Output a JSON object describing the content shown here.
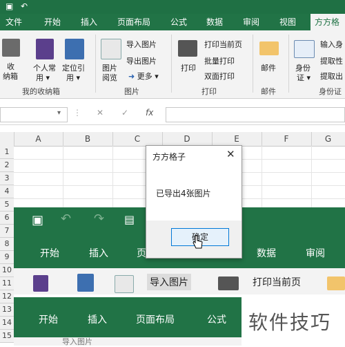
{
  "menu_tabs": [
    "文件",
    "开始",
    "插入",
    "页面布局",
    "公式",
    "数据",
    "审阅",
    "视图",
    "方方格子"
  ],
  "ribbon": {
    "collection": {
      "label1": "收",
      "label2": "纳箱",
      "group": "我的收纳箱"
    },
    "personal": {
      "label1": "个人常",
      "label2": "用 ▾"
    },
    "locate": {
      "label1": "定位引",
      "label2": "用 ▾"
    },
    "pic_browse": {
      "label1": "图片",
      "label2": "阅览"
    },
    "import_pic": "导入图片",
    "export_pic": "导出图片",
    "more": "更多 ▾",
    "pic_group": "图片",
    "print": "打印",
    "print_current": "打印当前页",
    "batch_print": "批量打印",
    "duplex_print": "双面打印",
    "print_group": "打印",
    "mail": "邮件",
    "mail_group": "邮件",
    "id_card": {
      "label1": "身份",
      "label2": "证 ▾"
    },
    "input_id": "输入身",
    "extract1": "提取性",
    "extract2": "提取出",
    "id_group": "身份证"
  },
  "formula_bar": {
    "cancel": "✕",
    "confirm": "✓",
    "fx": "fx"
  },
  "columns": [
    "A",
    "B",
    "C",
    "D",
    "E",
    "F",
    "G"
  ],
  "rows": [
    "1",
    "2",
    "3",
    "4",
    "5",
    "6",
    "7",
    "8",
    "9",
    "10",
    "11",
    "12",
    "13",
    "14",
    "15"
  ],
  "overlay1": {
    "tabs": [
      "开始",
      "插入",
      "页面布局",
      "数据",
      "审阅"
    ]
  },
  "overlay_ribbon": {
    "import_pic": "导入图片",
    "print_current": "打印当前页"
  },
  "overlay2": {
    "tabs": [
      "开始",
      "插入",
      "页面布局",
      "公式"
    ]
  },
  "overlay3_text": "导入图片",
  "dialog": {
    "title": "方方格子",
    "message": "已导出4张图片",
    "ok": "确定",
    "close": "✕"
  },
  "watermark": "软件技巧"
}
